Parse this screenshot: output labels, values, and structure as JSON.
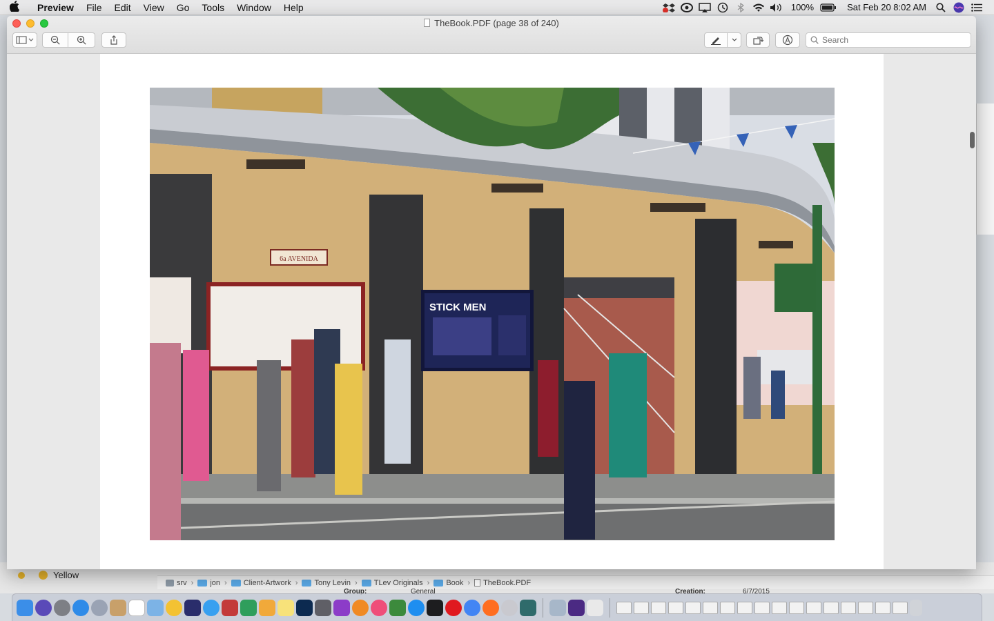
{
  "menubar": {
    "apple": "",
    "app_name": "Preview",
    "items": [
      "File",
      "Edit",
      "View",
      "Go",
      "Tools",
      "Window",
      "Help"
    ],
    "battery": "100%",
    "clock": "Sat Feb 20  8:02 AM"
  },
  "window": {
    "title": "TheBook.PDF (page 38 of 240)",
    "search_placeholder": "Search"
  },
  "background": {
    "tag_label": "Yellow",
    "pathbar": [
      "srv",
      "jon",
      "Client-Artwork",
      "Tony Levin",
      "TLev Originals",
      "Book",
      "TheBook.PDF"
    ],
    "group_label": "Group:",
    "group_value": "General",
    "creation_label": "Creation:",
    "creation_value": "6/7/2015"
  },
  "photo": {
    "street_sign": "6a AVENIDA",
    "poster_title": "STICK MEN"
  },
  "colors": {
    "sky": "#d9dde4",
    "building_wall": "#d2b079",
    "awning": "#c9ccd2",
    "pillar": "#3a3a3c",
    "sidewalk": "#8d8e8c",
    "poster": "#1e2557"
  }
}
